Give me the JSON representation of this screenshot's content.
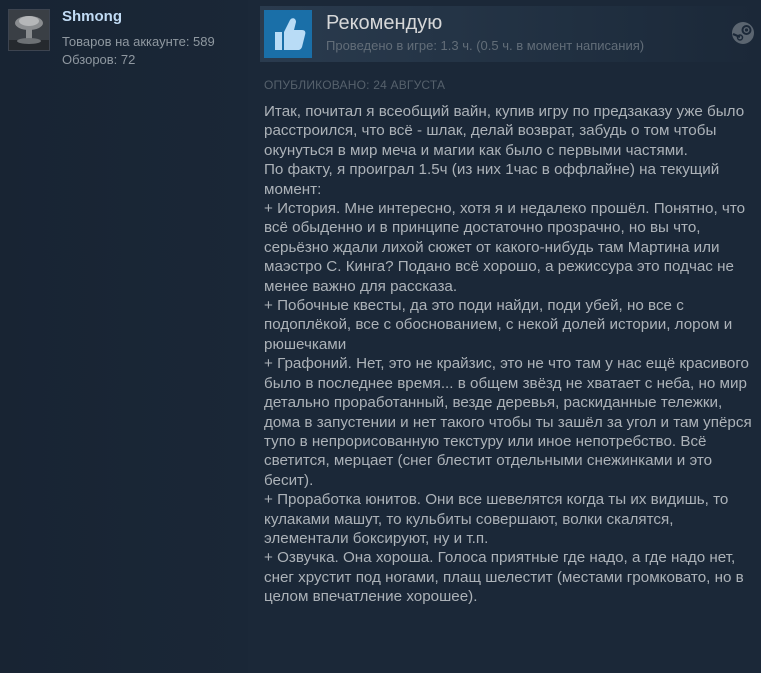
{
  "author": {
    "name": "Shmong",
    "products_owned": "Товаров на аккаунте: 589",
    "reviews_count": "Обзоров: 72"
  },
  "review": {
    "verdict": "Рекомендую",
    "playtime": "Проведено в игре: 1.3 ч. (0.5 ч. в момент написания)",
    "posted_date": "Опубликовано: 24 августа",
    "paragraphs": [
      "Итак, почитал я всеобщий вайн, купив игру по предзаказу уже было расстроился, что всё - шлак, делай возврат, забудь о том чтобы окунуться в мир меча и магии как было с первыми частями.",
      "По факту, я проиграл 1.5ч (из них 1час в оффлайне) на текущий момент:",
      "+ История. Мне интересно, хотя я и недалеко прошёл. Понятно, что всё обыденно и в принципе достаточно прозрачно, но вы что, серьёзно ждали лихой сюжет от какого-нибудь там Мартина или маэстро С. Кинга? Подано всё хорошо, а режиссура это подчас не менее важно для рассказа.",
      "+ Побочные квесты, да это поди найди, поди убей, но все с подоплёкой, все с обоснованием, с некой долей истории, лором и рюшечками",
      "+ Графоний. Нет, это не крайзис, это не что там у нас ещё красивого было в последнее время... в общем звёзд не хватает с неба, но мир детально проработанный, везде деревья, раскиданные тележки, дома в запустении и нет такого чтобы ты зашёл за угол и там упёрся тупо в непрорисованную текстуру или иное непотребство. Всё светится, мерцает (снег блестит отдельными снежинками и это бесит).",
      "+ Проработка юнитов. Они все шевелятся когда ты их видишь, то кулаками машут, то кульбиты совершают, волки скалятся, элементали боксируют, ну и т.п.",
      "+ Озвучка. Она хороша. Голоса приятные где надо, а где надо нет, снег хрустит под ногами, плащ шелестит (местами громковато, но в целом впечатление хорошее)."
    ]
  },
  "icons": {
    "avatar": "avatar-image",
    "verdict": "thumbs-up-icon",
    "platform": "steam-icon"
  },
  "colors": {
    "background": "#1b2838",
    "username": "#c1dbf4",
    "thumb_bg": "#1a6fa8",
    "text": "#acb2b8"
  }
}
